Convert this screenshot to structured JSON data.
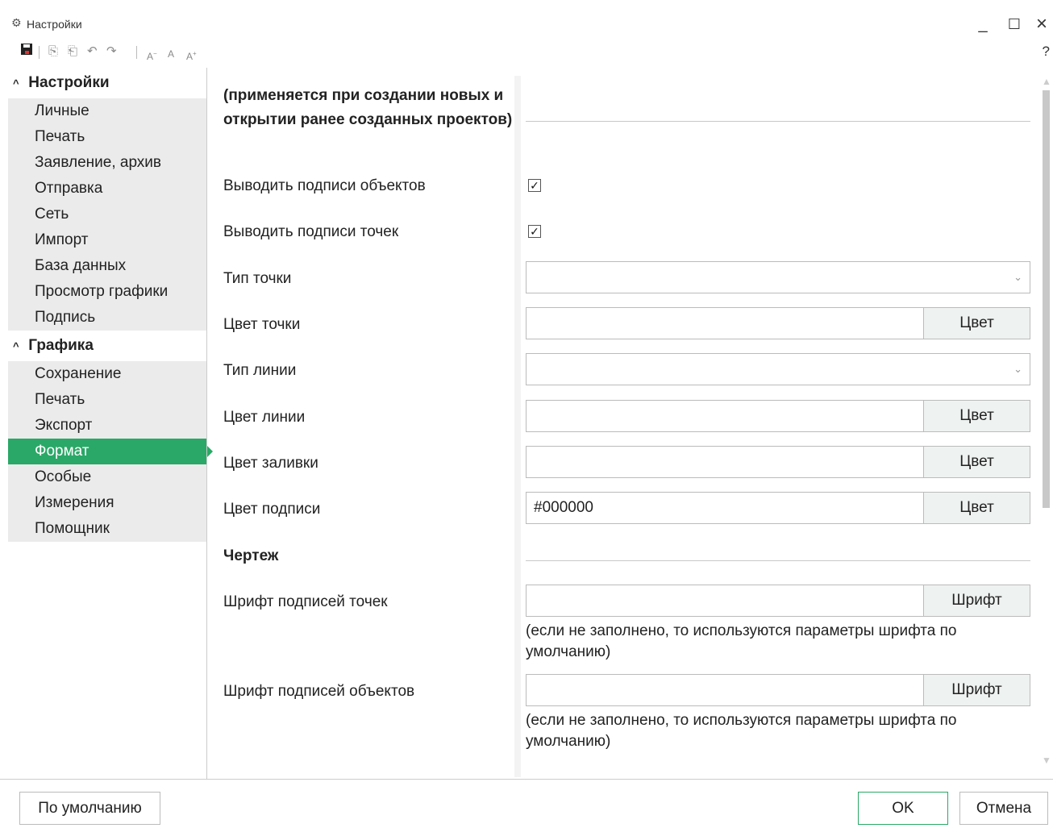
{
  "window": {
    "icon": "gears-icon",
    "title": "Настройки",
    "minimize": "_",
    "maximize": "☐",
    "close": "×"
  },
  "toolbar": {
    "icons": [
      "save-icon",
      "copy-icon",
      "paste-icon",
      "undo-icon",
      "redo-icon",
      "font-decrease-icon",
      "font-reset-icon",
      "font-increase-icon"
    ],
    "help": "?"
  },
  "sidebar": {
    "groups": [
      {
        "label": "Настройки",
        "items": [
          "Личные",
          "Печать",
          "Заявление, архив",
          "Отправка",
          "Сеть",
          "Импорт",
          "База данных",
          "Просмотр графики",
          "Подпись"
        ]
      },
      {
        "label": "Графика",
        "items": [
          "Сохранение",
          "Печать",
          "Экспорт",
          "Формат",
          "Особые",
          "Измерения",
          "Помощник"
        ]
      }
    ],
    "active_item": "Формат"
  },
  "content": {
    "section_heading": "(применяется при создании новых и открытии ранее созданных проектов)",
    "fields": {
      "show_object_labels": {
        "label": "Выводить подписи объектов",
        "checked": true
      },
      "show_point_labels": {
        "label": "Выводить подписи точек",
        "checked": true
      },
      "point_type": {
        "label": "Тип точки",
        "value": ""
      },
      "point_color": {
        "label": "Цвет точки",
        "value": "",
        "button": "Цвет"
      },
      "line_type": {
        "label": "Тип линии",
        "value": ""
      },
      "line_color": {
        "label": "Цвет линии",
        "value": "",
        "button": "Цвет"
      },
      "fill_color": {
        "label": "Цвет заливки",
        "value": "",
        "button": "Цвет"
      },
      "label_color": {
        "label": "Цвет подписи",
        "value": "#000000",
        "button": "Цвет"
      }
    },
    "drawing_heading": "Чертеж",
    "fonts": {
      "point_label_font": {
        "label": "Шрифт подписей точек",
        "value": "",
        "button": "Шрифт",
        "hint": "(если не заполнено, то используются параметры шрифта по умолчанию)"
      },
      "object_label_font": {
        "label": "Шрифт подписей объектов",
        "value": "",
        "button": "Шрифт",
        "hint": "(если не заполнено, то используются параметры шрифта по умолчанию)"
      }
    }
  },
  "footer": {
    "defaults_button": "По умолчанию",
    "ok_button": "OK",
    "cancel_button": "Отмена"
  },
  "colors": {
    "accent": "#2aa867",
    "nav_bg": "#ebebeb",
    "button_bg": "#eef2f0"
  }
}
